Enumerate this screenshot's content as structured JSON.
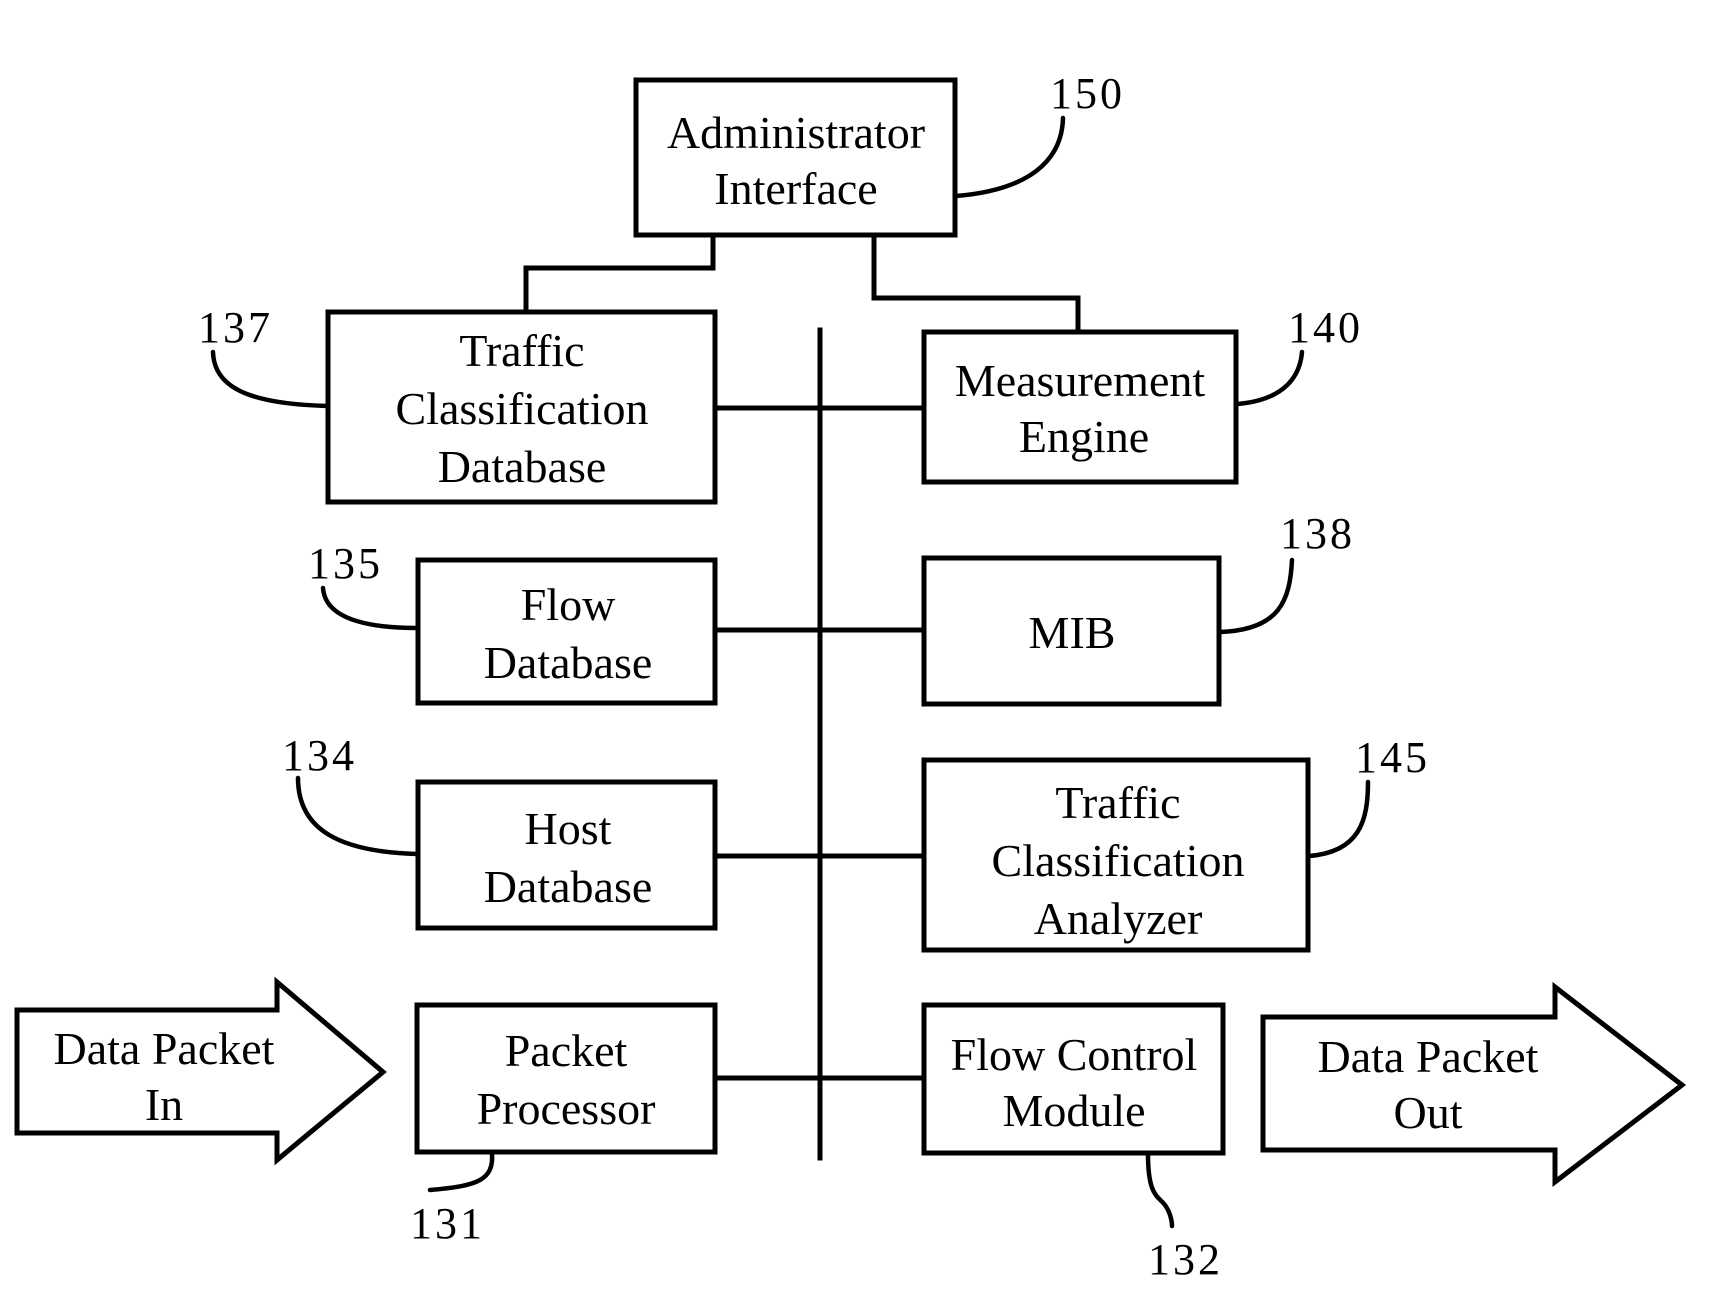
{
  "diagram": {
    "blocks": {
      "admin_interface": {
        "lines": [
          "Administrator",
          "Interface"
        ],
        "ref": "150"
      },
      "traffic_class_db": {
        "lines": [
          "Traffic",
          "Classification",
          "Database"
        ],
        "ref": "137"
      },
      "measurement_engine": {
        "lines": [
          "Measurement",
          "Engine"
        ],
        "ref": "140"
      },
      "flow_db": {
        "lines": [
          "Flow",
          "Database"
        ],
        "ref": "135"
      },
      "mib": {
        "lines": [
          "MIB"
        ],
        "ref": "138"
      },
      "host_db": {
        "lines": [
          "Host",
          "Database"
        ],
        "ref": "134"
      },
      "traffic_class_analyzer": {
        "lines": [
          "Traffic",
          "Classification",
          "Analyzer"
        ],
        "ref": "145"
      },
      "packet_processor": {
        "lines": [
          "Packet",
          "Processor"
        ],
        "ref": "131"
      },
      "flow_control_module": {
        "lines": [
          "Flow Control",
          "Module"
        ],
        "ref": "132"
      }
    },
    "arrows": {
      "packet_in": {
        "lines": [
          "Data Packet",
          "In"
        ]
      },
      "packet_out": {
        "lines": [
          "Data Packet",
          "Out"
        ]
      }
    }
  }
}
